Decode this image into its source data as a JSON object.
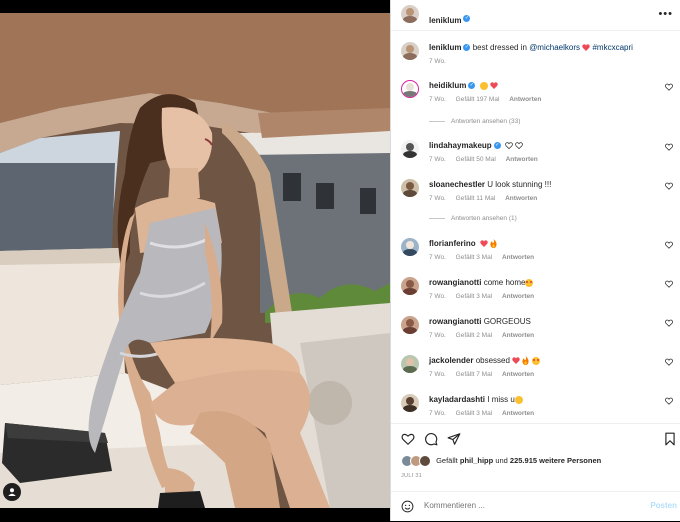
{
  "post": {
    "author": "leniklum",
    "caption": {
      "username": "leniklum",
      "text": "best dressed in",
      "mention": "@michaelkors",
      "hashtag": "#mkcxcapri",
      "time": "7 Wo."
    },
    "menu_icon": "more-horizontal-icon"
  },
  "comments": [
    {
      "username": "heidiklum",
      "verified": true,
      "text": "",
      "emoji": [
        "smiling-face",
        "red-heart"
      ],
      "time": "7 Wo.",
      "likes": "Gefällt 197 Mal",
      "reply": "Antworten",
      "view_replies": "Antworten ansehen (33)"
    },
    {
      "username": "lindahaymakeup",
      "verified": true,
      "text": "",
      "emoji": [
        "white-heart",
        "white-heart"
      ],
      "time": "7 Wo.",
      "likes": "Gefällt 50 Mal",
      "reply": "Antworten"
    },
    {
      "username": "sloanechestler",
      "verified": false,
      "text": "U look stunning !!!",
      "time": "7 Wo.",
      "likes": "Gefällt 11 Mal",
      "reply": "Antworten",
      "view_replies": "Antworten ansehen (1)"
    },
    {
      "username": "florianferino",
      "verified": false,
      "text": "",
      "emoji": [
        "red-heart",
        "fire"
      ],
      "time": "7 Wo.",
      "likes": "Gefällt 3 Mal",
      "reply": "Antworten"
    },
    {
      "username": "rowangianotti",
      "verified": false,
      "text": "come home",
      "emoji": [
        "heart-eyes"
      ],
      "time": "7 Wo.",
      "likes": "Gefällt 3 Mal",
      "reply": "Antworten"
    },
    {
      "username": "rowangianotti",
      "verified": false,
      "text": "GORGEOUS",
      "time": "7 Wo.",
      "likes": "Gefällt 2 Mal",
      "reply": "Antworten"
    },
    {
      "username": "jackolender",
      "verified": false,
      "text": "obsessed",
      "emoji": [
        "red-heart",
        "fire",
        "heart-eyes"
      ],
      "time": "7 Wo.",
      "likes": "Gefällt 7 Mal",
      "reply": "Antworten"
    },
    {
      "username": "kayladardashti",
      "verified": false,
      "text": "I miss u",
      "emoji": [
        "smiling-face"
      ],
      "time": "7 Wo.",
      "likes": "Gefällt 3 Mal",
      "reply": "Antworten"
    }
  ],
  "likes": {
    "prefix": "Gefällt",
    "user": "phil_hipp",
    "middle": "und",
    "count": "225.915 weitere Personen"
  },
  "date": "JULI 31",
  "add_comment": {
    "placeholder": "Kommentieren ...",
    "post_label": "Posten"
  },
  "colors": {
    "verified": "#3897f0",
    "heart_red": "#ed4956",
    "link": "#00376b",
    "muted": "#8e8e8e",
    "post_disabled": "#b2dffc"
  }
}
